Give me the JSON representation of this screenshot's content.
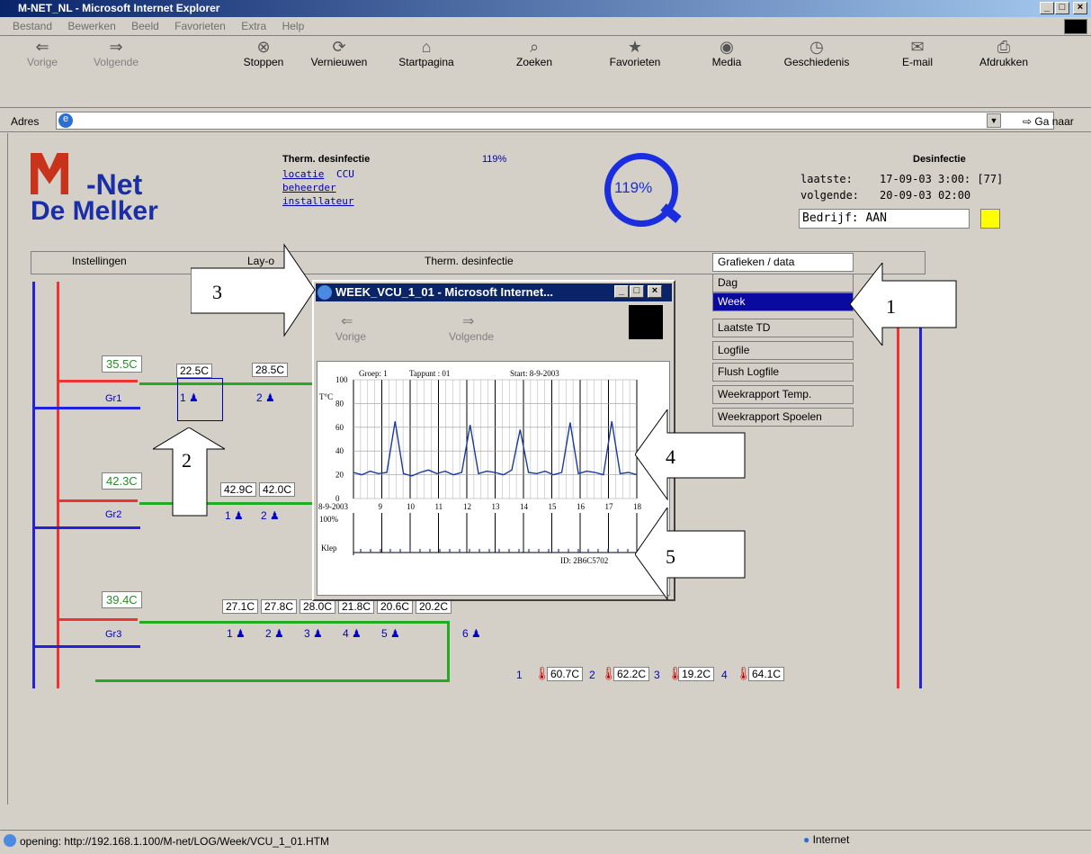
{
  "window": {
    "title": "M-NET_NL - Microsoft Internet Explorer"
  },
  "menu": [
    "Bestand",
    "Bewerken",
    "Beeld",
    "Favorieten",
    "Extra",
    "Help"
  ],
  "toolbar": {
    "back": "Vorige",
    "forward": "Volgende",
    "stop": "Stoppen",
    "refresh": "Vernieuwen",
    "home": "Startpagina",
    "search": "Zoeken",
    "favorites": "Favorieten",
    "media": "Media",
    "history": "Geschiedenis",
    "mail": "E-mail",
    "print": "Afdrukken"
  },
  "address": {
    "label": "Adres",
    "go": "Ga naar"
  },
  "logo": {
    "line1": "-Net",
    "line2": "De Melker"
  },
  "header": {
    "title": "Therm. desinfectie",
    "percent": "119%",
    "links": [
      "locatie",
      "beheerder",
      "installateur"
    ],
    "location_value": "CCU",
    "gauge": "119%"
  },
  "desinfectie": {
    "title": "Desinfectie",
    "last_label": "laatste:",
    "last_value": "17-09-03 3:00: [77]",
    "next_label": "volgende:",
    "next_value": "20-09-03 02:00",
    "company": "Bedrijf: AAN"
  },
  "nav": {
    "settings": "Instellingen",
    "layout": "Lay-o",
    "therm": "Therm. desinfectie",
    "graphs": "Grafieken / data"
  },
  "dropdown": [
    "Dag",
    "Week",
    "Laatste TD",
    "Logfile",
    "Flush Logfile",
    "Weekrapport Temp.",
    "Weekrapport Spoelen"
  ],
  "groups": [
    {
      "name": "Gr1",
      "temp": "35.5C",
      "taps": [
        "22.5C",
        "28.5C"
      ]
    },
    {
      "name": "Gr2",
      "temp": "42.3C",
      "taps": [
        "42.9C",
        "42.0C"
      ]
    },
    {
      "name": "Gr3",
      "temp": "39.4C",
      "taps": [
        "27.1C",
        "27.8C",
        "28.0C",
        "21.8C",
        "20.6C",
        "20.2C"
      ]
    }
  ],
  "tap_numbers": [
    "1",
    "2",
    "3",
    "4",
    "5",
    "6"
  ],
  "sensors": [
    {
      "n": "1",
      "v": "60.7C"
    },
    {
      "n": "2",
      "v": "62.2C"
    },
    {
      "n": "3",
      "v": "19.2C"
    },
    {
      "n": "4",
      "v": "64.1C"
    }
  ],
  "callouts": [
    "1",
    "2",
    "3",
    "4",
    "5"
  ],
  "popup": {
    "title": "WEEK_VCU_1_01 - Microsoft Internet...",
    "back": "Vorige",
    "forward": "Volgende",
    "chart_header": {
      "group": "Groep: 1",
      "tap": "Tappunt : 01",
      "start": "Start: 8-9-2003"
    },
    "ylabel": "T°C",
    "klep_label": "Klep",
    "klep_pct": "100%",
    "id": "ID: 2B6C5702"
  },
  "chart_data": {
    "type": "line",
    "ylim": [
      0,
      100
    ],
    "yticks": [
      "100",
      "80",
      "60",
      "40",
      "20",
      "0"
    ],
    "xticks": [
      "8-9-2003",
      "9",
      "10",
      "11",
      "12",
      "13",
      "14",
      "15",
      "16",
      "17",
      "18"
    ],
    "series": [
      {
        "values": [
          22,
          20,
          23,
          21,
          22,
          65,
          21,
          19,
          22,
          24,
          21,
          23,
          20,
          22,
          62,
          21,
          23,
          22,
          20,
          24,
          58,
          22,
          21,
          23,
          20,
          22,
          64,
          21,
          23,
          22,
          20,
          65,
          21,
          22,
          20
        ]
      }
    ],
    "grid": true
  },
  "status": {
    "text": "opening: http://192.168.1.100/M-net/LOG/Week/VCU_1_01.HTM",
    "zone": "Internet"
  }
}
